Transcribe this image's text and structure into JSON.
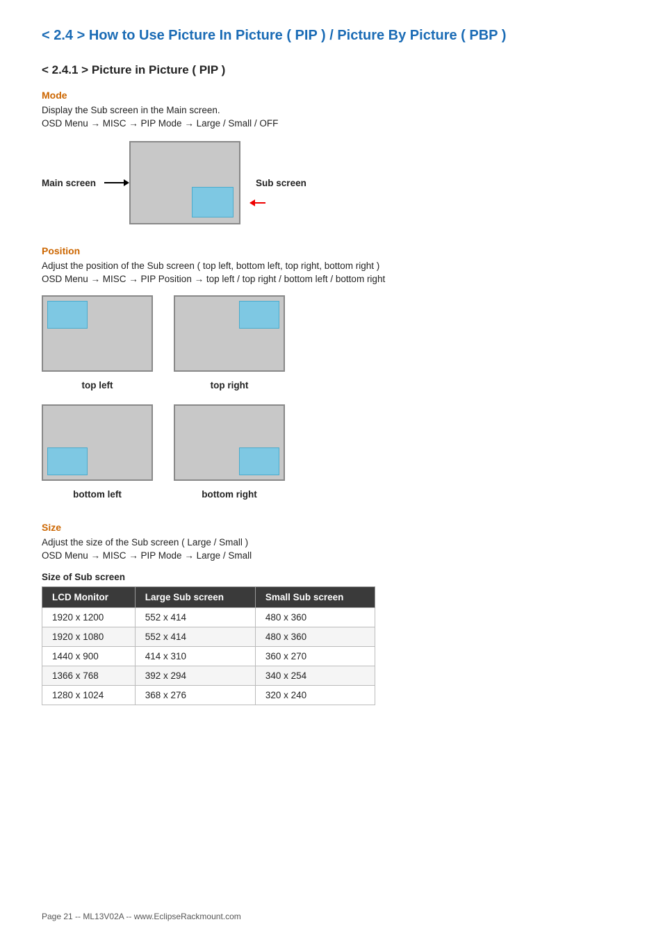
{
  "page": {
    "main_title": "< 2.4 > How to Use Picture In Picture ( PIP )  /  Picture By Picture ( PBP )",
    "section_241_title": "< 2.4.1 > Picture in Picture ( PIP )",
    "mode_heading": "Mode",
    "mode_desc1": "Display the Sub screen in the Main screen.",
    "mode_desc2": "OSD Menu  →  MISC  →  PIP Mode  →  Large  /  Small  /  OFF",
    "main_screen_label": "Main screen",
    "sub_screen_label": "Sub screen",
    "position_heading": "Position",
    "position_desc1": "Adjust the position of the Sub screen  ( top left, bottom left, top right, bottom right )",
    "position_desc2": "OSD Menu  →  MISC  →  PIP Position  →  top left  /  top right  /  bottom left  /  bottom right",
    "pos_top_left": "top left",
    "pos_top_right": "top right",
    "pos_bottom_left": "bottom left",
    "pos_bottom_right": "bottom right",
    "size_heading": "Size",
    "size_desc1": "Adjust the size of the Sub screen  ( Large  /  Small )",
    "size_desc2": "OSD Menu  →  MISC  →  PIP Mode  →  Large  /  Small",
    "table_title": "Size of Sub screen",
    "table_headers": [
      "LCD Monitor",
      "Large Sub screen",
      "Small Sub screen"
    ],
    "table_rows": [
      [
        "1920 x 1200",
        "552 x 414",
        "480 x 360"
      ],
      [
        "1920 x 1080",
        "552 x 414",
        "480 x 360"
      ],
      [
        "1440 x 900",
        "414 x 310",
        "360 x 270"
      ],
      [
        "1366 x 768",
        "392 x 294",
        "340 x 254"
      ],
      [
        "1280 x 1024",
        "368 x 276",
        "320 x 240"
      ]
    ],
    "footer_text": "Page 21 -- ML13V02A -- www.EclipseRackmount.com"
  }
}
